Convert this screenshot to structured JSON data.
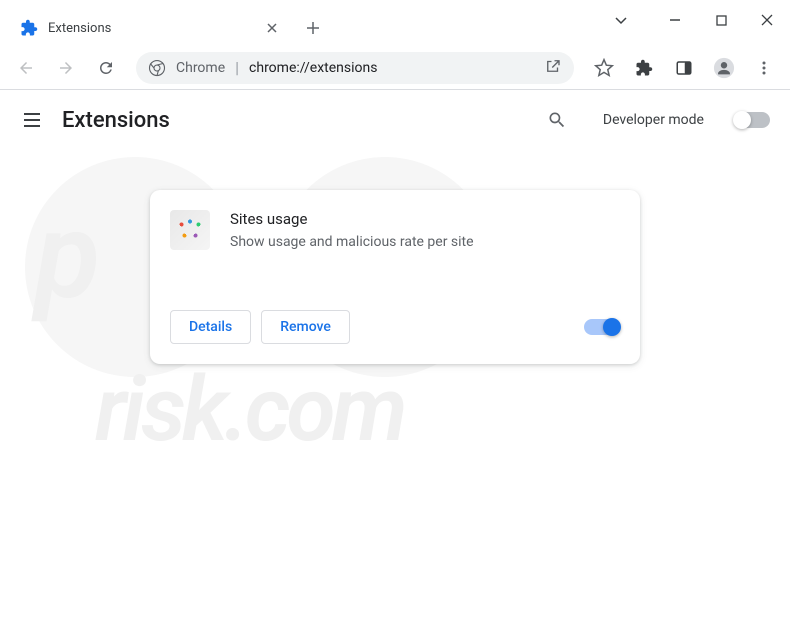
{
  "tab": {
    "title": "Extensions"
  },
  "addressbar": {
    "chrome_label": "Chrome",
    "url": "chrome://extensions"
  },
  "header": {
    "title": "Extensions",
    "dev_mode_label": "Developer mode",
    "dev_mode_on": false
  },
  "extension": {
    "name": "Sites usage",
    "description": "Show usage and malicious rate per site",
    "details_label": "Details",
    "remove_label": "Remove",
    "enabled": true
  }
}
